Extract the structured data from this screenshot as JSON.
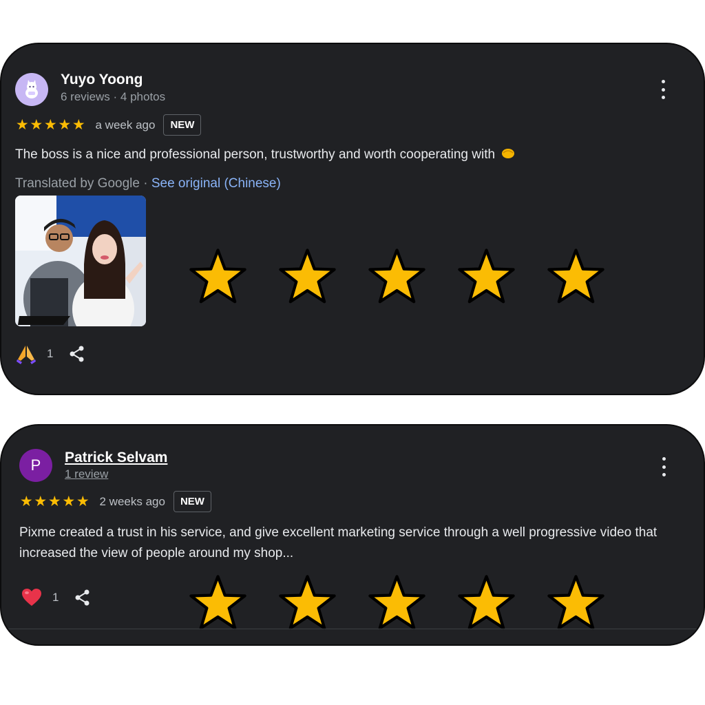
{
  "reviews": [
    {
      "author": "Yuyo Yoong",
      "meta": "6 reviews · 4 photos",
      "avatar_icon": "cat-illustration-icon",
      "rating": 5,
      "time": "a week ago",
      "badge": "NEW",
      "text": "The boss is a nice and professional person, trustworthy and worth cooperating with",
      "text_emoji": "handshake-icon",
      "translated_label": "Translated by Google · ",
      "see_original": "See original (Chinese)",
      "reaction_icon": "folded-hands-icon",
      "reaction_count": "1",
      "share_icon": "share-icon"
    },
    {
      "author": "Patrick Selvam",
      "meta": "1 review",
      "avatar_letter": "P",
      "rating": 5,
      "time": "2 weeks ago",
      "badge": "NEW",
      "text": "Pixme created a trust in his service, and give excellent marketing service through a well progressive video that increased the view of people around my shop...",
      "reaction_icon": "heart-icon",
      "reaction_count": "1",
      "share_icon": "share-icon"
    }
  ],
  "colors": {
    "card_bg": "#202124",
    "star": "#fbbc04",
    "link": "#8ab4f8"
  },
  "overlay_stars": 5
}
